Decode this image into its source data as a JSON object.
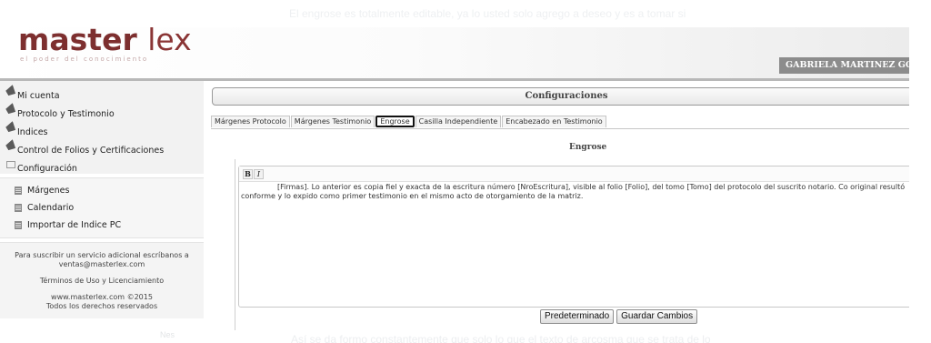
{
  "ghost": {
    "top_text": "El engrose es totalmente editable, ya lo usted solo agrego a deseo y es a tomar si",
    "bottom_text": "Así se da formo constantemente que solo lo que el texto de arcosma que se trata de lo",
    "cut_text": "Nes"
  },
  "header": {
    "logo_main": "master ",
    "logo_lex": "lex",
    "logo_tagline": "el poder del conocimiento",
    "user_name": "GABRIELA MARTINEZ GOU"
  },
  "sidebar": {
    "items": [
      {
        "label": "Mi cuenta"
      },
      {
        "label": "Protocolo y Testimonio"
      },
      {
        "label": "Indices"
      },
      {
        "label": "Control de Folios y Certificaciones"
      },
      {
        "label": "Configuración"
      }
    ],
    "subitems": [
      {
        "label": "Márgenes"
      },
      {
        "label": "Calendario"
      },
      {
        "label": "Importar de Indice PC"
      }
    ],
    "footer": {
      "contact": "Para suscribir un servicio adicional escríbanos a ventas@masterlex.com",
      "terms": "Términos de Uso y Licenciamiento",
      "site": "www.masterlex.com ©2015",
      "rights": "Todos los derechos reservados"
    }
  },
  "main": {
    "title": "Configuraciones",
    "tabs": [
      {
        "label": "Márgenes Protocolo"
      },
      {
        "label": "Márgenes Testimonio"
      },
      {
        "label": "Engrose"
      },
      {
        "label": "Casilla Independiente"
      },
      {
        "label": "Encabezado en Testimonio"
      }
    ],
    "active_tab": "Engrose",
    "section_title": "Engrose",
    "editor": {
      "bold_label": "B",
      "italic_label": "I",
      "content": "[Firmas]. Lo anterior es copia fiel y exacta de la escritura número [NroEscritura], visible al folio [Folio], del tomo [Tomo] del protocolo del suscrito notario. Co original resultó conforme y lo expido como primer testimonio en el mismo acto de otorgamiento de la matriz."
    },
    "buttons": {
      "default_label": "Predeterminado",
      "save_label": "Guardar Cambios"
    }
  }
}
